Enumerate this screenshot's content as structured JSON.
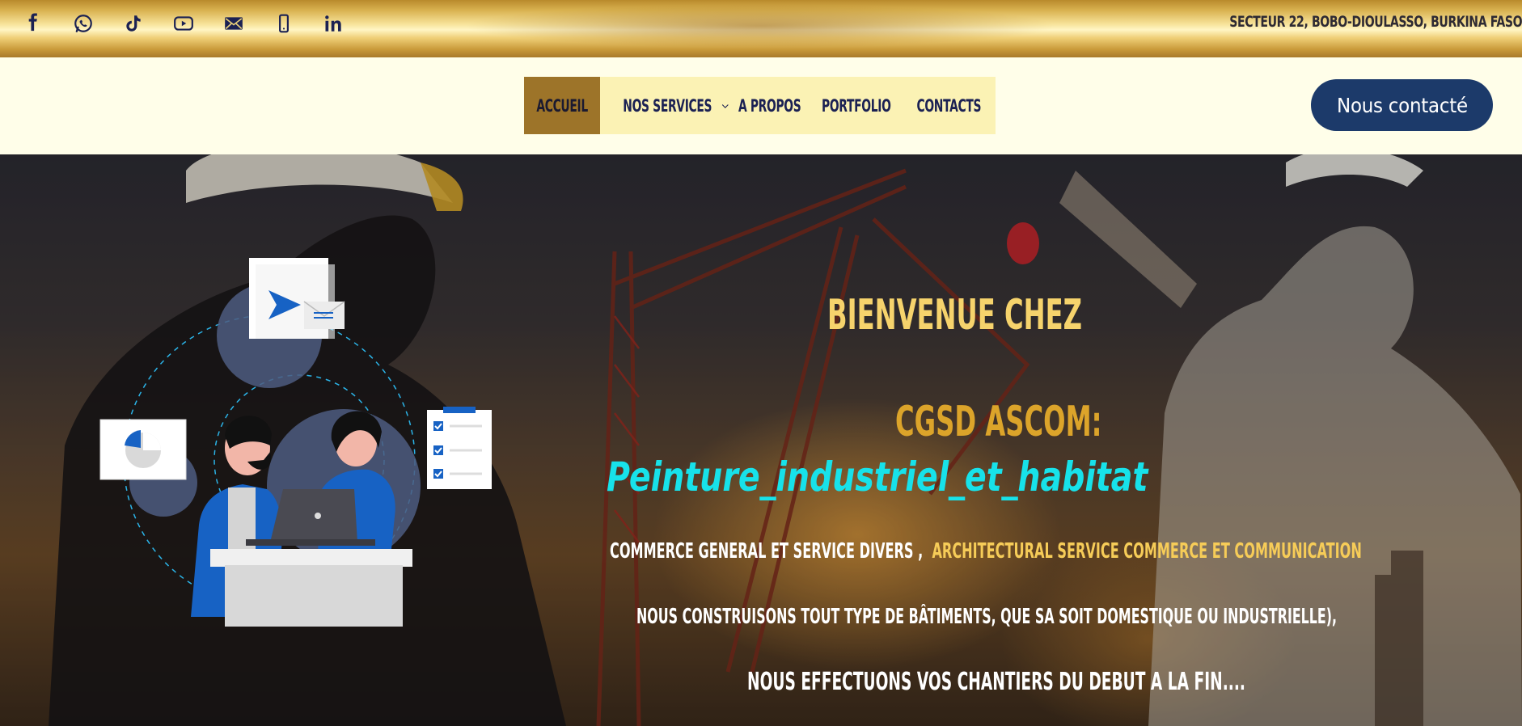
{
  "topbar": {
    "socials": [
      {
        "icon": "facebook-icon"
      },
      {
        "icon": "whatsapp-icon"
      },
      {
        "icon": "tiktok-icon"
      },
      {
        "icon": "youtube-icon"
      },
      {
        "icon": "mail-icon"
      },
      {
        "icon": "phone-icon"
      },
      {
        "icon": "linkedin-icon"
      }
    ],
    "address": "SECTEUR 22, BOBO-DIOULASSO, BURKINA FASO"
  },
  "nav": {
    "items": [
      {
        "label": "ACCUEIL",
        "active": true
      },
      {
        "label": "NOS SERVICES",
        "has_dropdown": true
      },
      {
        "label": "A PROPOS"
      },
      {
        "label": "PORTFOLIO"
      },
      {
        "label": "CONTACTS"
      }
    ]
  },
  "cta": {
    "label": "Nous contacté"
  },
  "hero": {
    "welcome": "BIENVENUE CHEZ",
    "company": "CGSD ASCOM:",
    "typed": "Peinture_industriel_et_habitat",
    "line1_white": "COMMERCE GENERAL ET SERVICE DIVERS ,",
    "line1_gold": "ARCHITECTURAL SERVICE COMMERCE  ET COMMUNICATION",
    "line2": "NOUS CONSTRUISONS TOUT TYPE DE BÂTIMENTS, QUE SA SOIT DOMESTIQUE OU INDUSTRIELLE),",
    "line3": "NOUS EFFECTUONS VOS CHANTIERS DU DEBUT A LA FIN...."
  },
  "colors": {
    "navy": "#1b2153",
    "cta_bg": "#1c3a6a",
    "nav_bg": "#fbf2b4",
    "nav_active": "#9d7429",
    "header_bg": "#fffee9",
    "gold_text": "#f6d36c",
    "cyan_text": "#17e2ea"
  }
}
